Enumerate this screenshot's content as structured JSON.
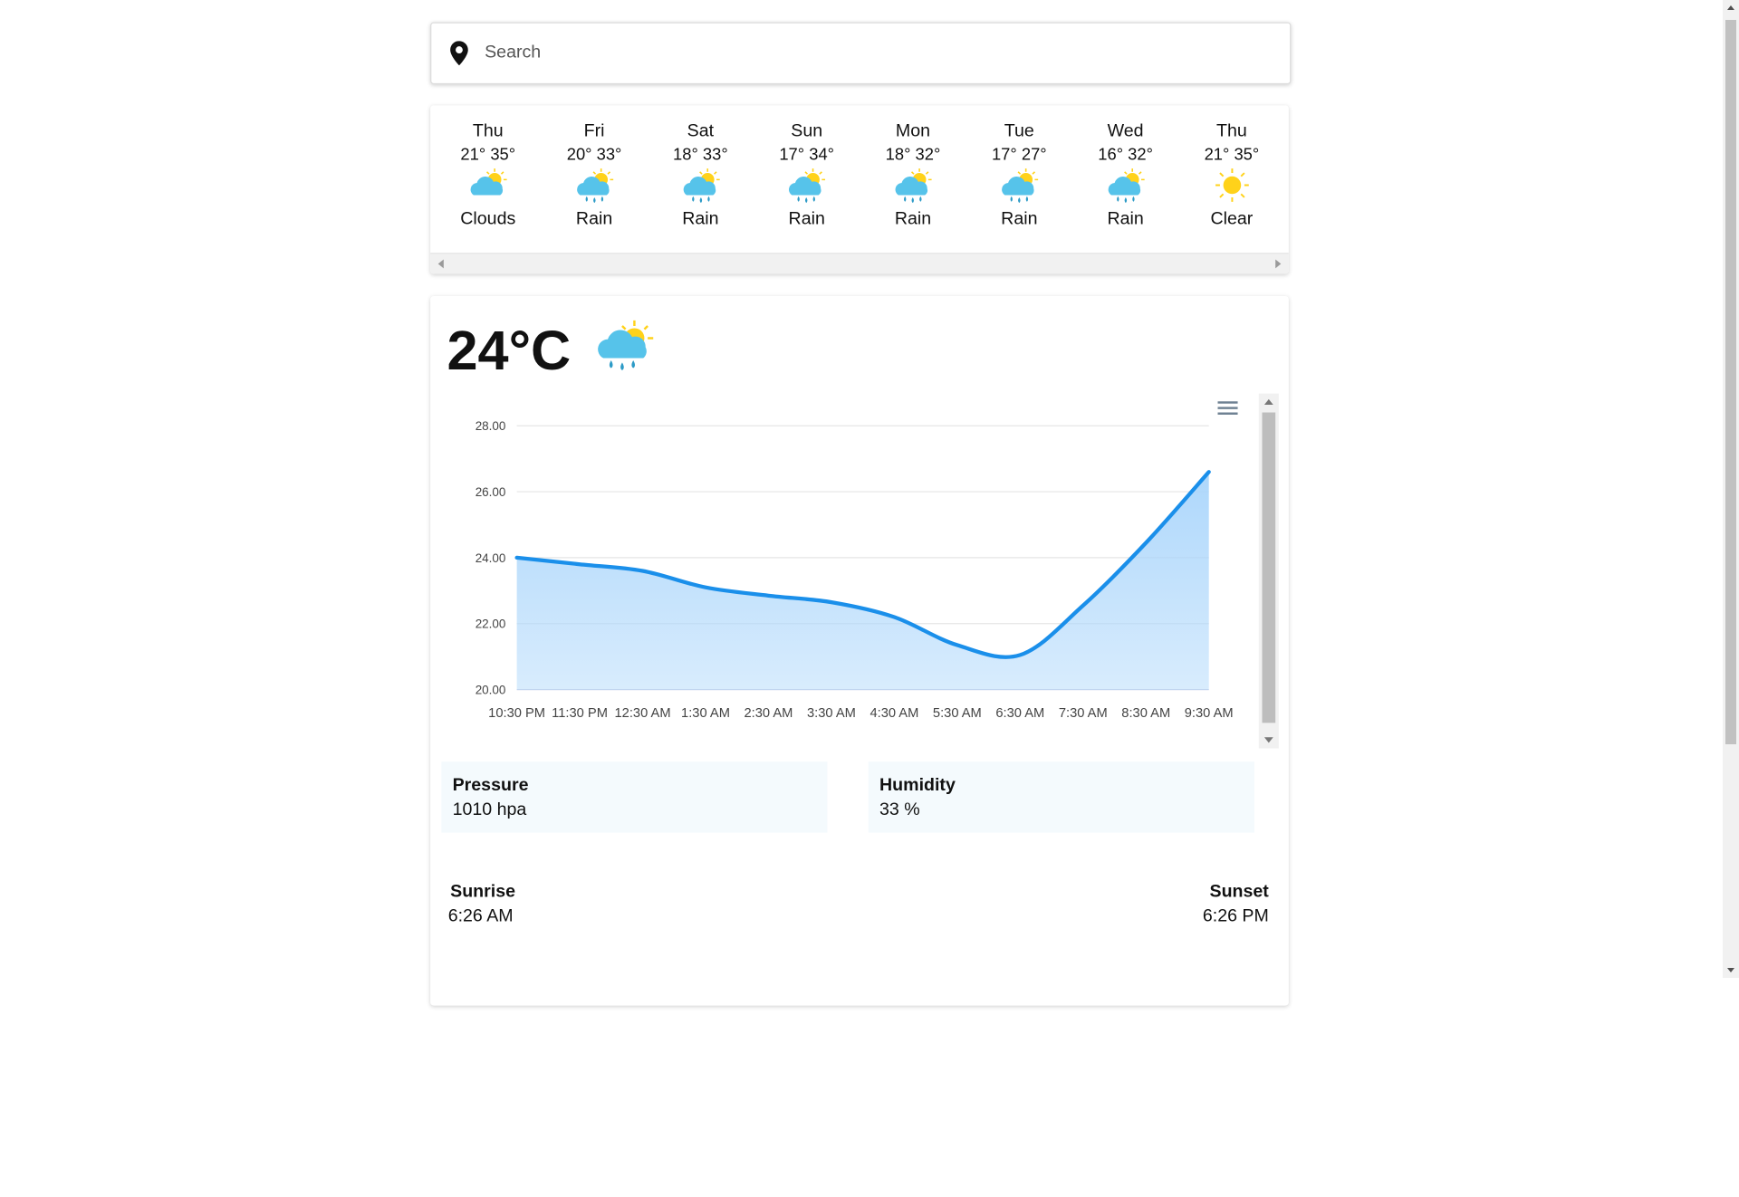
{
  "search": {
    "placeholder": "Search",
    "value": ""
  },
  "forecast": [
    {
      "day": "Thu",
      "low": "21°",
      "high": "35°",
      "condition": "Clouds",
      "icon": "sun-behind-cloud-icon"
    },
    {
      "day": "Fri",
      "low": "20°",
      "high": "33°",
      "condition": "Rain",
      "icon": "sun-cloud-rain-icon"
    },
    {
      "day": "Sat",
      "low": "18°",
      "high": "33°",
      "condition": "Rain",
      "icon": "sun-cloud-rain-icon"
    },
    {
      "day": "Sun",
      "low": "17°",
      "high": "34°",
      "condition": "Rain",
      "icon": "sun-cloud-rain-icon"
    },
    {
      "day": "Mon",
      "low": "18°",
      "high": "32°",
      "condition": "Rain",
      "icon": "sun-cloud-rain-icon"
    },
    {
      "day": "Tue",
      "low": "17°",
      "high": "27°",
      "condition": "Rain",
      "icon": "sun-cloud-rain-icon"
    },
    {
      "day": "Wed",
      "low": "16°",
      "high": "32°",
      "condition": "Rain",
      "icon": "sun-cloud-rain-icon"
    },
    {
      "day": "Thu",
      "low": "21°",
      "high": "35°",
      "condition": "Clear",
      "icon": "sun-icon"
    }
  ],
  "current": {
    "temperature": "24°C",
    "icon": "sun-cloud-rain-icon"
  },
  "chart_data": {
    "type": "area",
    "title": "",
    "xlabel": "",
    "ylabel": "",
    "categories": [
      "10:30 PM",
      "11:30 PM",
      "12:30 AM",
      "1:30 AM",
      "2:30 AM",
      "3:30 AM",
      "4:30 AM",
      "5:30 AM",
      "6:30 AM",
      "7:30 AM",
      "8:30 AM",
      "9:30 AM"
    ],
    "values": [
      24.0,
      23.8,
      23.6,
      23.1,
      22.85,
      22.65,
      22.2,
      21.35,
      21.05,
      22.55,
      24.45,
      26.6
    ],
    "y_ticks": [
      "20.00",
      "22.00",
      "24.00",
      "26.00",
      "28.00"
    ],
    "ylim": [
      20,
      28
    ],
    "grid": true,
    "line_color": "#1a8fea",
    "fill_color": "#a9d5fb"
  },
  "pressure": {
    "label": "Pressure",
    "value": "1010 hpa"
  },
  "humidity": {
    "label": "Humidity",
    "value": "33 %"
  },
  "sunrise": {
    "label": "Sunrise",
    "value": "6:26 AM"
  },
  "sunset": {
    "label": "Sunset",
    "value": "6:26 PM"
  },
  "colors": {
    "accent": "#1a8fea",
    "stat_bg": "#f4fafd",
    "sun": "#ffd21a",
    "cloud": "#56c3ea"
  }
}
